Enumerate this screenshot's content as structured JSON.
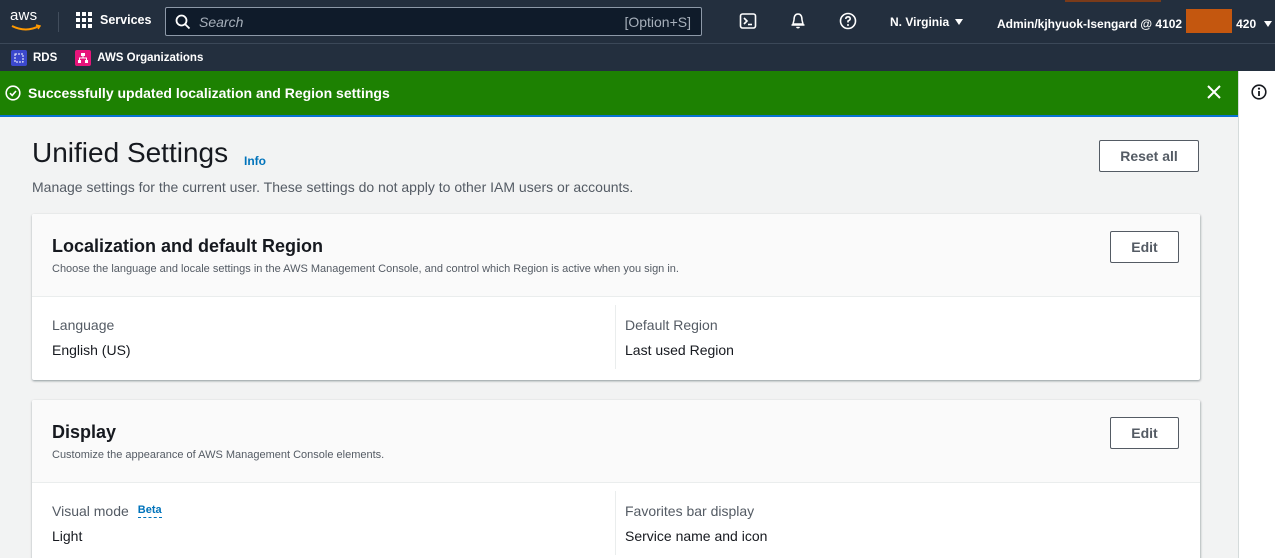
{
  "topnav": {
    "logo_text": "aws",
    "services_label": "Services",
    "search_placeholder": "Search",
    "search_shortcut": "[Option+S]",
    "region_label": "N. Virginia",
    "account_prefix": "Admin/kjhyuok-Isengard @ 4102",
    "account_suffix": "420",
    "icons": [
      "grid-icon",
      "search-icon",
      "cloudshell-icon",
      "bell-icon",
      "help-icon",
      "caret-down-icon"
    ]
  },
  "favorites": [
    {
      "label": "RDS",
      "icon": "rds-icon",
      "color": "#3b48cc"
    },
    {
      "label": "AWS Organizations",
      "icon": "organizations-icon",
      "color": "#e7157b"
    }
  ],
  "flash": {
    "message": "Successfully updated localization and Region settings",
    "color": "#1d8102"
  },
  "page": {
    "title": "Unified Settings",
    "info_link": "Info",
    "description": "Manage settings for the current user. These settings do not apply to other IAM users or accounts.",
    "reset_label": "Reset all"
  },
  "cards": {
    "localization": {
      "title": "Localization and default Region",
      "subtitle": "Choose the language and locale settings in the AWS Management Console, and control which Region is active when you sign in.",
      "edit_label": "Edit",
      "left_label": "Language",
      "left_value": "English (US)",
      "right_label": "Default Region",
      "right_value": "Last used Region"
    },
    "display": {
      "title": "Display",
      "subtitle": "Customize the appearance of AWS Management Console elements.",
      "edit_label": "Edit",
      "left_label": "Visual mode",
      "left_badge": "Beta",
      "left_value": "Light",
      "right_label": "Favorites bar display",
      "right_value": "Service name and icon"
    }
  }
}
